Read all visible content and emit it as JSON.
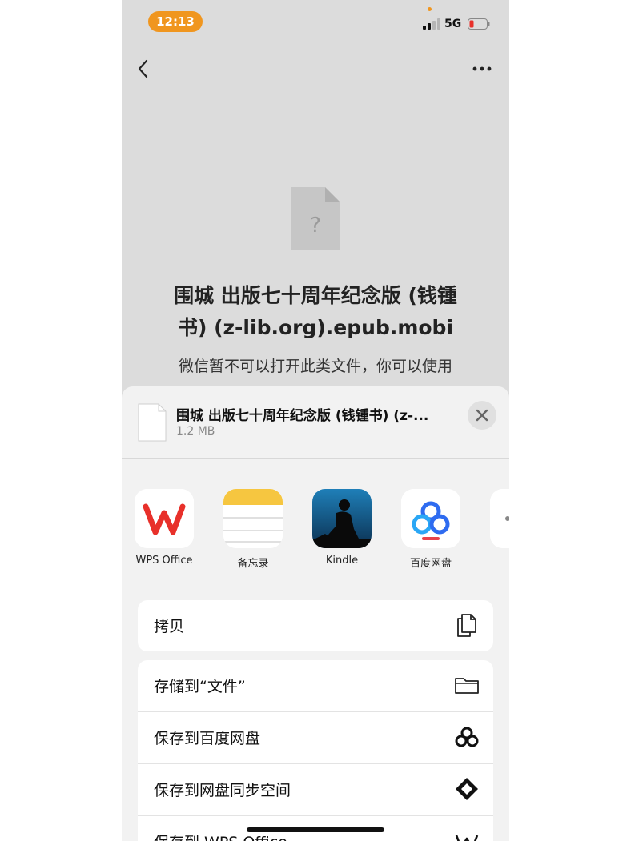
{
  "status": {
    "time": "12:13",
    "network": "5G"
  },
  "doc": {
    "title_line1": "围城  出版七十周年纪念版 (钱锺",
    "title_line2": "书) (z-lib.org).epub.mobi",
    "desc": "微信暂不可以打开此类文件，你可以使用"
  },
  "sheet": {
    "file_name": "围城  出版七十周年纪念版 (钱锺书) (z-...",
    "file_size": "1.2 MB",
    "apps": [
      {
        "label": "WPS Office",
        "icon": "wps-office-icon"
      },
      {
        "label": "备忘录",
        "icon": "notes-icon"
      },
      {
        "label": "Kindle",
        "icon": "kindle-icon"
      },
      {
        "label": "百度网盘",
        "icon": "baidu-netdisk-icon"
      }
    ],
    "actions": [
      {
        "label": "拷贝",
        "icon": "copy-icon"
      },
      {
        "label": "存储到“文件”",
        "icon": "folder-icon"
      },
      {
        "label": "保存到百度网盘",
        "icon": "baidu-netdisk-icon"
      },
      {
        "label": "保存到网盘同步空间",
        "icon": "sync-space-icon"
      },
      {
        "label": "保存到 WPS Office",
        "icon": "wps-office-icon"
      }
    ]
  },
  "colors": {
    "accent_orange": "#f0961f",
    "wps_red": "#e8302a",
    "kindle_blue": "#1f7fb8"
  }
}
